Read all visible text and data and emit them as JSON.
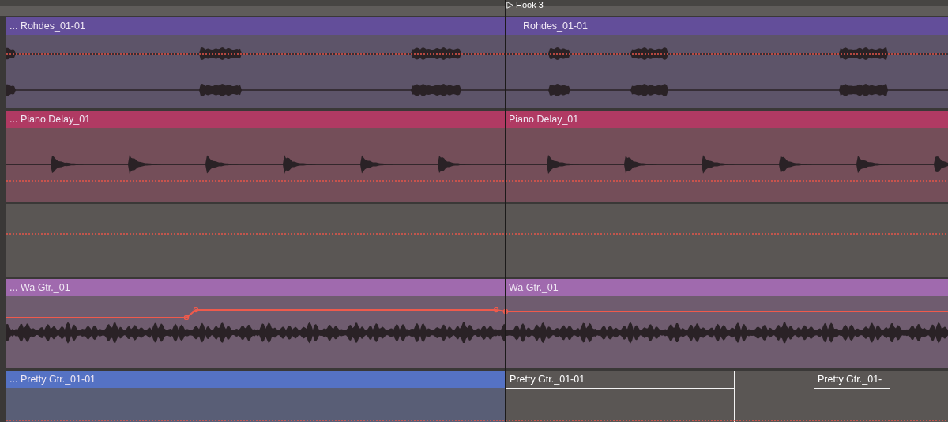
{
  "locator": {
    "label": "Hook 3"
  },
  "tracks": [
    {
      "color": "#634e9a",
      "automation": {
        "kind": "dotted"
      },
      "clips": [
        {
          "name": "... Rohdes_01-01",
          "kind": "sparse"
        },
        {
          "name": "Rohdes_01-01",
          "kind": "sparse"
        }
      ]
    },
    {
      "color": "#b03a63",
      "automation": {
        "kind": "dotted"
      },
      "clips": [
        {
          "name": "... Piano Delay_01",
          "kind": "hits"
        },
        {
          "name": "Piano Delay_01",
          "kind": "hits"
        }
      ]
    },
    {
      "color": "#5a5654",
      "automation": {
        "kind": "dotted"
      }
    },
    {
      "color": "#a06aae",
      "automation": {
        "kind": "solid"
      },
      "clips": [
        {
          "name": "... Wa Gtr._01",
          "kind": "dense"
        },
        {
          "name": "Wa Gtr._01",
          "kind": "dense"
        }
      ]
    },
    {
      "color": "#5572c4",
      "automation": {
        "kind": "dotted"
      },
      "clips": [
        {
          "name": "... Pretty Gtr._01-01",
          "kind": "empty"
        },
        {
          "name": "Pretty Gtr._01-01",
          "kind": "outline"
        },
        {
          "name": "Pretty Gtr._01-",
          "kind": "outline"
        }
      ]
    }
  ]
}
